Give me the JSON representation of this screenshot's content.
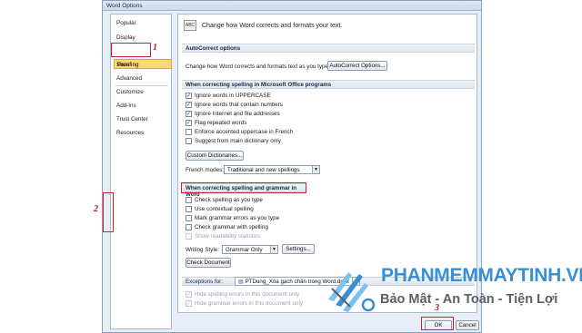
{
  "window": {
    "title": "Word Options"
  },
  "nav": {
    "items": [
      "Popular",
      "Display",
      "Proofing",
      "Save",
      "Advanced",
      "Customize",
      "Add-Ins",
      "Trust Center",
      "Resources"
    ],
    "selected": "Proofing"
  },
  "annotations": {
    "step1": "1",
    "step2": "2",
    "step3": "3"
  },
  "header": {
    "icon_label": "ABC",
    "text": "Change how Word corrects and formats your text."
  },
  "autocorrect": {
    "section": "AutoCorrect options",
    "description": "Change how Word corrects and formats text as you type:",
    "button": "AutoCorrect Options..."
  },
  "office_spelling": {
    "section": "When correcting spelling in Microsoft Office programs",
    "options": [
      {
        "label": "Ignore words in UPPERCASE",
        "checked": true
      },
      {
        "label": "Ignore words that contain numbers",
        "checked": true
      },
      {
        "label": "Ignore Internet and file addresses",
        "checked": true
      },
      {
        "label": "Flag repeated words",
        "checked": true
      },
      {
        "label": "Enforce accented uppercase in French",
        "checked": false
      },
      {
        "label": "Suggest from main dictionary only",
        "checked": false
      }
    ],
    "custom_dictionaries_button": "Custom Dictionaries...",
    "french_modes_label": "French modes:",
    "french_modes_value": "Traditional and new spellings"
  },
  "word_spelling": {
    "section": "When correcting spelling and grammar in Word",
    "options": [
      {
        "label": "Check spelling as you type",
        "checked": false
      },
      {
        "label": "Use contextual spelling",
        "checked": false
      },
      {
        "label": "Mark grammar errors as you type",
        "checked": false
      },
      {
        "label": "Check grammar with spelling",
        "checked": false
      },
      {
        "label": "Show readability statistics",
        "checked": false
      }
    ],
    "writing_style_label": "Writing Style:",
    "writing_style_value": "Grammar Only",
    "settings_button": "Settings...",
    "check_document_button": "Check Document"
  },
  "exceptions": {
    "label": "Exceptions for:",
    "document": "PTDung_Xóa gạch chân trong Word.docx",
    "options": [
      {
        "label": "Hide spelling errors in this document only",
        "checked": true
      },
      {
        "label": "Hide grammar errors in this document only",
        "checked": true
      }
    ]
  },
  "footer": {
    "ok": "OK",
    "cancel": "Cancel"
  },
  "watermark": {
    "title": "PHANMEMMAYTINH.VN",
    "tagline": "Bảo Mật - An Toàn - Tiện Lợi"
  },
  "colors": {
    "highlight": "#fbd776",
    "annotation": "#d0202a",
    "brand_blue": "#3a8fd3"
  }
}
